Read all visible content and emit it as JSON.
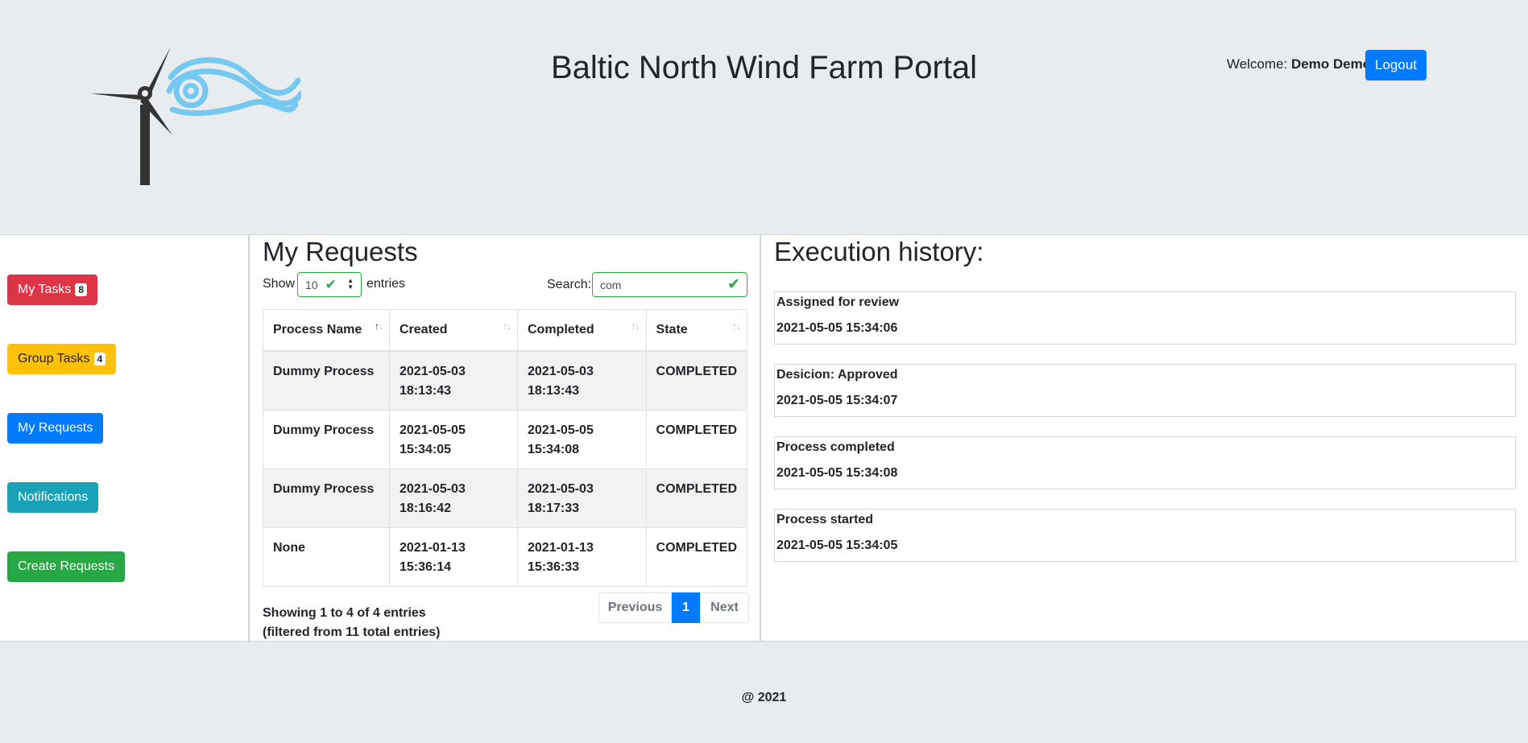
{
  "header": {
    "title": "Baltic North Wind Farm Portal",
    "welcome_prefix": "Welcome:",
    "user_name": "Demo Demo",
    "logout_label": "Logout"
  },
  "sidebar": {
    "items": [
      {
        "label": "My Tasks",
        "badge": "8",
        "color": "#dc3545"
      },
      {
        "label": "Group Tasks",
        "badge": "4",
        "color": "#ffc107"
      },
      {
        "label": "My Requests",
        "color": "#007bff"
      },
      {
        "label": "Notifications",
        "color": "#17a2b8"
      },
      {
        "label": "Create Requests",
        "color": "#28a745"
      }
    ]
  },
  "requests": {
    "title": "My Requests",
    "show_label": "Show",
    "page_length": "10",
    "entries_label": "entries",
    "search_label": "Search:",
    "search_value": "com",
    "columns": [
      "Process Name",
      "Created",
      "Completed",
      "State"
    ],
    "rows": [
      {
        "name": "Dummy Process",
        "created_date": "2021-05-03",
        "created_time": "18:13:43",
        "completed_date": "2021-05-03",
        "completed_time": "18:13:43",
        "state": "COMPLETED"
      },
      {
        "name": "Dummy Process",
        "created_date": "2021-05-05",
        "created_time": "15:34:05",
        "completed_date": "2021-05-05",
        "completed_time": "15:34:08",
        "state": "COMPLETED"
      },
      {
        "name": "Dummy Process",
        "created_date": "2021-05-03",
        "created_time": "18:16:42",
        "completed_date": "2021-05-03",
        "completed_time": "18:17:33",
        "state": "COMPLETED"
      },
      {
        "name": "None",
        "created_date": "2021-01-13",
        "created_time": "15:36:14",
        "completed_date": "2021-01-13",
        "completed_time": "15:36:33",
        "state": "COMPLETED"
      }
    ],
    "info_line1": "Showing 1 to 4 of 4 entries",
    "info_line2": "(filtered from 11 total entries)",
    "pager": {
      "previous": "Previous",
      "current": "1",
      "next": "Next"
    }
  },
  "history": {
    "title": "Execution history:",
    "events": [
      {
        "label": "Assigned for review",
        "time": "2021-05-05 15:34:06"
      },
      {
        "label": "Desicion: Approved",
        "time": "2021-05-05 15:34:07"
      },
      {
        "label": "Process completed",
        "time": "2021-05-05 15:34:08"
      },
      {
        "label": "Process started",
        "time": "2021-05-05 15:34:05"
      }
    ]
  },
  "footer": {
    "text": "@ 2021"
  },
  "colors": {
    "primary": "#007bff",
    "success": "#28a745",
    "danger": "#dc3545",
    "warning": "#ffc107",
    "info": "#17a2b8",
    "logo_blue": "#75c9f0",
    "logo_dark": "#333333"
  }
}
